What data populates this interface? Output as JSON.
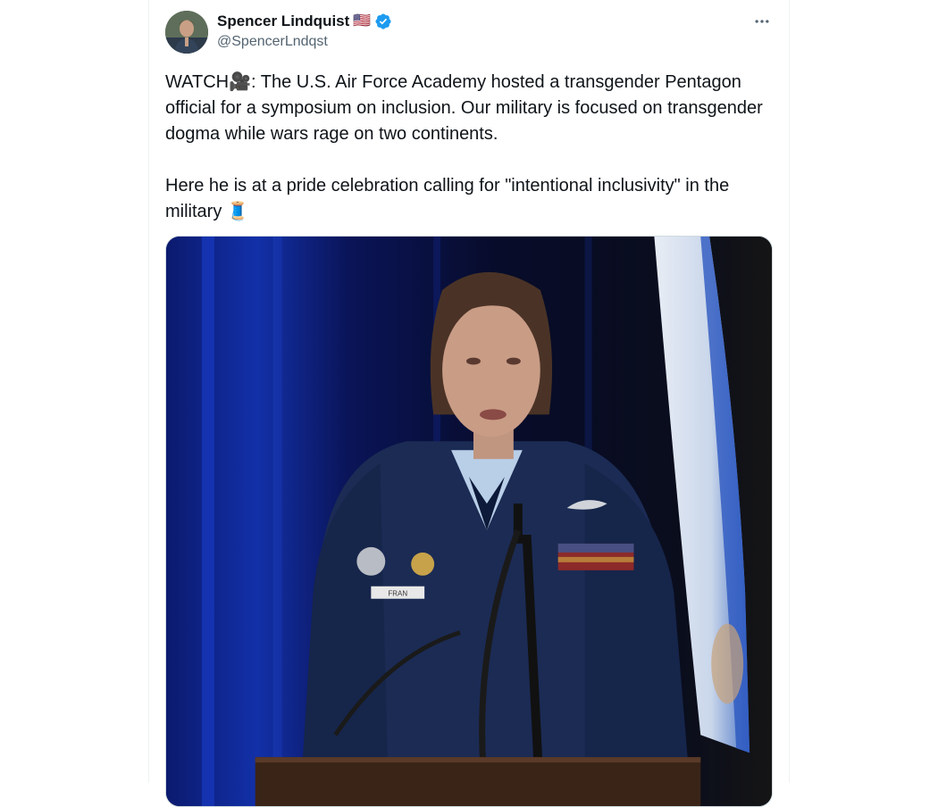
{
  "tweet": {
    "author": {
      "display_name": "Spencer Lindquist",
      "flag": "🇺🇸",
      "verified": true,
      "handle": "@SpencerLndqst",
      "avatar_icon": "user-avatar"
    },
    "text_paragraph_1": "WATCH🎥: The U.S. Air Force Academy hosted a transgender Pentagon official for a symposium on  inclusion. Our military is focused on transgender dogma while wars rage on two continents.",
    "text_paragraph_2": "Here he is at a pride celebration calling for \"intentional inclusivity\" in the military 🧵",
    "media": {
      "type": "video",
      "name_tag": "FRAN"
    }
  },
  "colors": {
    "text_primary": "#0f1419",
    "text_secondary": "#536471",
    "verified_blue": "#1d9bf0",
    "border": "#eff3f4"
  },
  "icons": {
    "more": "more-horizontal-icon",
    "verified": "verified-badge-icon"
  }
}
